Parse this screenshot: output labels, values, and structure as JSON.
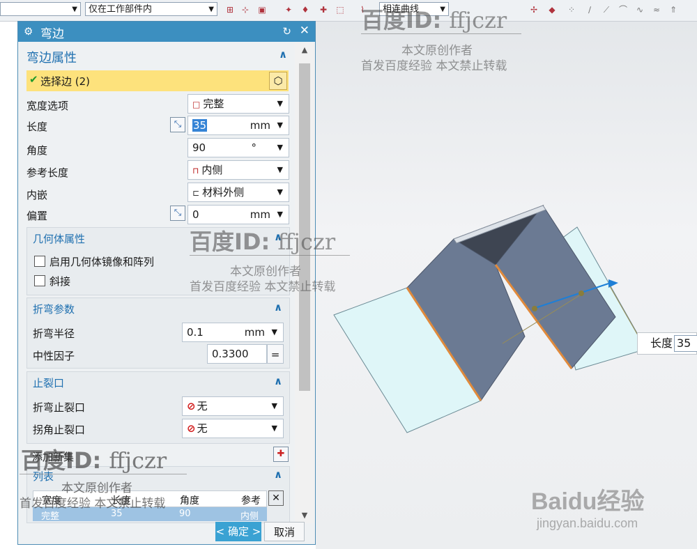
{
  "toolbar": {
    "filter_left_value": "",
    "scope_value": "仅在工作部件内",
    "curve_rule_value": "相连曲线"
  },
  "dialog": {
    "title": "弯边",
    "section_properties": "弯边属性",
    "select_edge": "选择边 (2)",
    "width_option_label": "宽度选项",
    "width_option_value": "完整",
    "length_label": "长度",
    "length_value": "35",
    "length_unit": "mm",
    "angle_label": "角度",
    "angle_value": "90",
    "angle_unit": "°",
    "ref_length_label": "参考长度",
    "ref_length_value": "内侧",
    "inset_label": "内嵌",
    "inset_value": "材料外侧",
    "offset_label": "偏置",
    "offset_value": "0",
    "offset_unit": "mm",
    "geometry_section": "几何体属性",
    "mirror_pattern_label": "启用几何体镜像和阵列",
    "miter_label": "斜接",
    "bend_section": "折弯参数",
    "bend_radius_label": "折弯半径",
    "bend_radius_value": "0.1",
    "bend_radius_unit": "mm",
    "neutral_factor_label": "中性因子",
    "neutral_factor_value": "0.3300",
    "neutral_factor_eq": "=",
    "relief_section": "止裂口",
    "bend_relief_label": "折弯止裂口",
    "bend_relief_value": "无",
    "corner_relief_label": "拐角止裂口",
    "corner_relief_value": "无",
    "add_new_set_label": "添加新集",
    "list_section": "列表",
    "list_columns": [
      "宽度",
      "长度",
      "角度",
      "参考"
    ],
    "list_rows": [
      [
        "完整",
        "35",
        "90",
        "内侧"
      ]
    ],
    "ok_label": "< 确定 >",
    "cancel_label": "取消"
  },
  "viewport": {
    "dim_label": "长度",
    "dim_value": "35"
  },
  "watermarks": {
    "id_prefix": "百度ID:",
    "id_user": "ffjczr",
    "line1": "本文原创作者",
    "line2": "首发百度经验   本文禁止转载",
    "brand": "Baidu经验",
    "url": "jingyan.baidu.com"
  },
  "colors": {
    "title_bar": "#3c8fc0",
    "selection_highlight": "#fde27c",
    "ok_button": "#3aa2d3",
    "flange_face": "#6b7a93",
    "base_face": "#dff6f8",
    "bend_edge": "#e08a3c"
  }
}
